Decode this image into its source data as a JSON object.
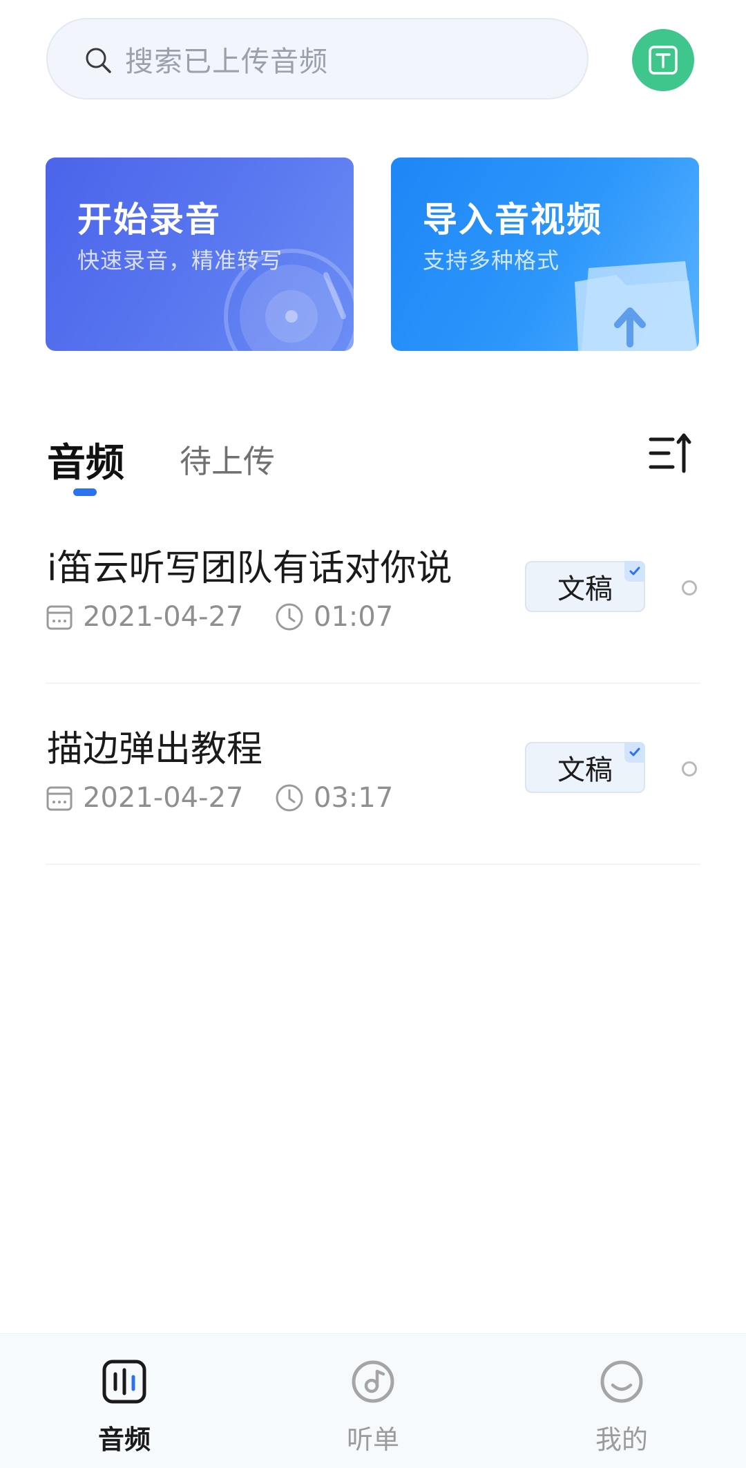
{
  "search": {
    "placeholder": "搜索已上传音频"
  },
  "header": {
    "avatar_icon": "text-t-icon",
    "accent_color": "#3fc68d"
  },
  "cards": [
    {
      "title": "开始录音",
      "subtitle": "快速录音，精准转写",
      "color": "#4b64ea"
    },
    {
      "title": "导入音视频",
      "subtitle": "支持多种格式",
      "color": "#1f86f6"
    }
  ],
  "tabs": {
    "audio": "音频",
    "pending": "待上传",
    "active_color": "#2a72f0"
  },
  "list": [
    {
      "title": "i笛云听写团队有话对你说",
      "date": "2021-04-27",
      "duration": "01:07",
      "badge": "文稿"
    },
    {
      "title": "描边弹出教程",
      "date": "2021-04-27",
      "duration": "03:17",
      "badge": "文稿"
    }
  ],
  "nav": [
    {
      "label": "音频",
      "icon": "waveform-icon",
      "active": true
    },
    {
      "label": "听单",
      "icon": "disc-note-icon",
      "active": false
    },
    {
      "label": "我的",
      "icon": "smile-face-icon",
      "active": false
    }
  ]
}
